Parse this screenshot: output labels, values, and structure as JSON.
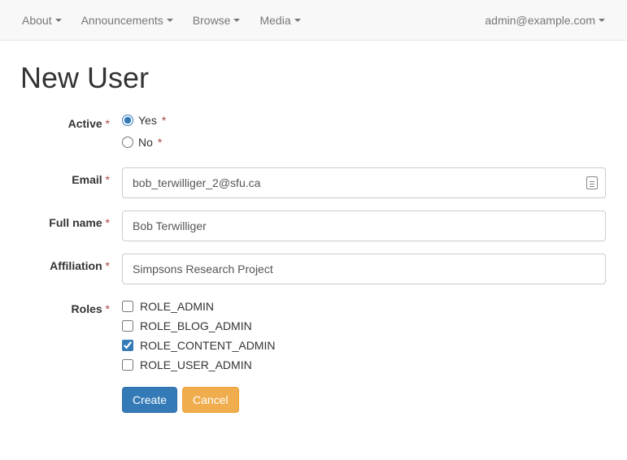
{
  "nav": {
    "left": [
      {
        "label": "About"
      },
      {
        "label": "Announcements"
      },
      {
        "label": "Browse"
      },
      {
        "label": "Media"
      }
    ],
    "right": {
      "label": "admin@example.com"
    }
  },
  "page_title": "New User",
  "form": {
    "active": {
      "label": "Active",
      "yes": "Yes",
      "no": "No",
      "value": "yes"
    },
    "email": {
      "label": "Email",
      "value": "bob_terwilliger_2@sfu.ca"
    },
    "fullname": {
      "label": "Full name",
      "value": "Bob Terwilliger"
    },
    "affiliation": {
      "label": "Affiliation",
      "value": "Simpsons Research Project"
    },
    "roles": {
      "label": "Roles",
      "options": [
        {
          "label": "ROLE_ADMIN",
          "checked": false
        },
        {
          "label": "ROLE_BLOG_ADMIN",
          "checked": false
        },
        {
          "label": "ROLE_CONTENT_ADMIN",
          "checked": true
        },
        {
          "label": "ROLE_USER_ADMIN",
          "checked": false
        }
      ]
    },
    "buttons": {
      "create": "Create",
      "cancel": "Cancel"
    }
  },
  "required_marker": "*"
}
